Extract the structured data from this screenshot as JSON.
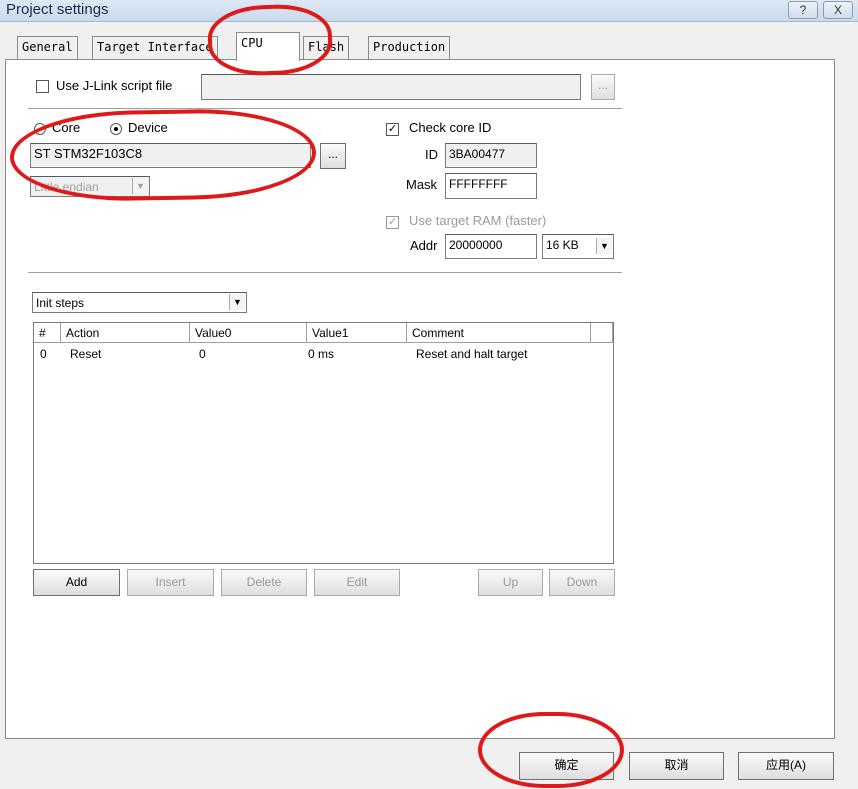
{
  "window": {
    "title": "Project settings",
    "help_label": "?",
    "close_label": "X"
  },
  "tabs": [
    {
      "label": "General"
    },
    {
      "label": "Target Interface"
    },
    {
      "label": "CPU"
    },
    {
      "label": "Flash"
    },
    {
      "label": "Production"
    }
  ],
  "script": {
    "label": "Use J-Link script file",
    "path": "",
    "browse_label": "..."
  },
  "cpu": {
    "core_label": "Core",
    "device_label": "Device",
    "selected": "Device",
    "device_value": "ST STM32F103C8",
    "browse_label": "...",
    "endian_value": "Little endian"
  },
  "coreid": {
    "check_label": "Check core ID",
    "id_label": "ID",
    "id_value": "3BA00477",
    "mask_label": "Mask",
    "mask_value": "FFFFFFFF"
  },
  "ram": {
    "label": "Use target RAM (faster)",
    "addr_label": "Addr",
    "addr_value": "20000000",
    "size_value": "16 KB"
  },
  "init": {
    "dropdown_value": "Init steps",
    "columns": [
      "#",
      "Action",
      "Value0",
      "Value1",
      "Comment"
    ],
    "rows": [
      {
        "num": "0",
        "action": "Reset",
        "value0": "0",
        "value1": "0 ms",
        "comment": "Reset and halt target"
      }
    ],
    "buttons": {
      "add": "Add",
      "insert": "Insert",
      "delete": "Delete",
      "edit": "Edit",
      "up": "Up",
      "down": "Down"
    }
  },
  "dialog_buttons": {
    "ok": "确定",
    "cancel": "取消",
    "apply": "应用(A)"
  },
  "icons": {
    "dropdown": "chevron-down-icon",
    "check": "checkmark-icon"
  },
  "colors": {
    "annotation": "#e01818",
    "titlebar": "#c9d9ee"
  }
}
